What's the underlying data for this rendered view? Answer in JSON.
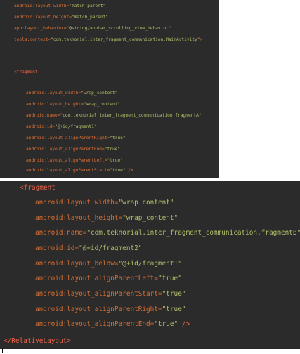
{
  "top_snippet": {
    "lines": [
      {
        "attr": "android:layout_width=",
        "val": "\"match_parent\"",
        "tail": ""
      },
      {
        "attr": "android:layout_height=",
        "val": "\"match_parent\"",
        "tail": ""
      },
      {
        "attr": "app:layout_behavior=",
        "val": "\"@string/appbar_scrolling_view_behavior\"",
        "tail": ""
      },
      {
        "attr": "tools:context=",
        "val": "\"com.teknorial.inter_fragment_communication.MainActivity\"",
        "tail": ">"
      },
      {
        "tag": "<fragment"
      },
      {
        "attr": "android:layout_width=",
        "val": "\"wrap_content\"",
        "tail": ""
      },
      {
        "attr": "android:layout_height=",
        "val": "\"wrap_content\"",
        "tail": ""
      },
      {
        "attr": "android:name=",
        "val": "\"com.teknorial.inter_fragment_communication.fragmentA\"",
        "tail": ""
      },
      {
        "attr": "android:id=",
        "val": "\"@+id/fragment1\"",
        "tail": ""
      },
      {
        "attr": "android:layout_alignParentRight=",
        "val": "\"true\"",
        "tail": ""
      },
      {
        "attr": "android:layout_alignParentEnd=",
        "val": "\"true\"",
        "tail": ""
      },
      {
        "attr": "android:layout_alignParentLeft=",
        "val": "\"true\"",
        "tail": ""
      },
      {
        "attr": "android:layout_alignParentStart=",
        "val": "\"true\"",
        "tail": " />"
      }
    ]
  },
  "bottom_snippet": {
    "lines": [
      {
        "tag": "<fragment"
      },
      {
        "attr": "android:layout_width=",
        "val": "\"wrap_content\"",
        "tail": ""
      },
      {
        "attr": "android:layout_height=",
        "val": "\"wrap_content\"",
        "tail": ""
      },
      {
        "attr": "android:name=",
        "val": "\"com.teknorial.inter_fragment_communication.fragmentB\"",
        "tail": ""
      },
      {
        "attr": "android:id=",
        "val": "\"@+id/fragment2\"",
        "tail": ""
      },
      {
        "attr": "android:layout_below=",
        "val": "\"@+id/fragment1\"",
        "tail": ""
      },
      {
        "attr": "android:layout_alignParentLeft=",
        "val": "\"true\"",
        "tail": ""
      },
      {
        "attr": "android:layout_alignParentStart=",
        "val": "\"true\"",
        "tail": ""
      },
      {
        "attr": "android:layout_alignParentRight=",
        "val": "\"true\"",
        "tail": ""
      },
      {
        "attr": "android:layout_alignParentEnd=",
        "val": "\"true\"",
        "tail": " />"
      },
      {
        "tag": "</RelativeLayout>"
      }
    ]
  },
  "colors": {
    "panel_background": "#2b2b2b",
    "attribute": "#d96f32",
    "value": "#b5bd68",
    "tag": "#e8624a"
  }
}
